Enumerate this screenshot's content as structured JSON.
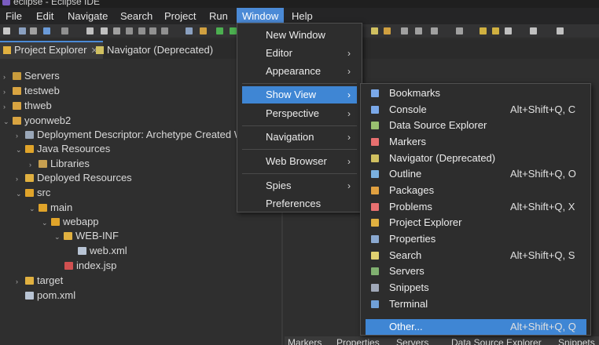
{
  "window": {
    "title": "eclipse - Eclipse IDE"
  },
  "menubar": [
    "File",
    "Edit",
    "Navigate",
    "Search",
    "Project",
    "Run",
    "Window",
    "Help"
  ],
  "tabs": {
    "project_explorer": "Project Explorer",
    "navigator": "Navigator (Deprecated)"
  },
  "tree": [
    {
      "label": "Servers",
      "icon_color": "#c89b3c"
    },
    {
      "label": "testweb",
      "icon_color": "#d9a441"
    },
    {
      "label": "thweb",
      "icon_color": "#d9a441"
    },
    {
      "label": "yoonweb2",
      "icon_color": "#d9a441"
    },
    {
      "label": "Deployment Descriptor: Archetype Created Web Application",
      "icon_color": "#9aa7b8"
    },
    {
      "label": "Java Resources",
      "icon_color": "#e0a42a"
    },
    {
      "label": "Libraries",
      "icon_color": "#c8a050"
    },
    {
      "label": "Deployed Resources",
      "icon_color": "#e0b040"
    },
    {
      "label": "src",
      "icon_color": "#e0a42a"
    },
    {
      "label": "main",
      "icon_color": "#e0a42a"
    },
    {
      "label": "webapp",
      "icon_color": "#e0a42a"
    },
    {
      "label": "WEB-INF",
      "icon_color": "#e0b040"
    },
    {
      "label": "web.xml",
      "icon_color": "#b8c4d4"
    },
    {
      "label": "index.jsp",
      "icon_color": "#d05050"
    },
    {
      "label": "target",
      "icon_color": "#e0b040"
    },
    {
      "label": "pom.xml",
      "icon_color": "#b8c4d4"
    }
  ],
  "window_menu": [
    {
      "label": "New Window",
      "arrow": ""
    },
    {
      "label": "Editor",
      "arrow": "›"
    },
    {
      "label": "Appearance",
      "arrow": "›"
    },
    {
      "label": "Show View",
      "arrow": "›"
    },
    {
      "label": "Perspective",
      "arrow": "›"
    },
    {
      "label": "Navigation",
      "arrow": "›"
    },
    {
      "label": "Web Browser",
      "arrow": "›"
    },
    {
      "label": "Spies",
      "arrow": "›"
    },
    {
      "label": "Preferences",
      "arrow": ""
    }
  ],
  "show_view_menu": [
    {
      "label": "Bookmarks",
      "shortcut": "",
      "icon_color": "#7aa8e8"
    },
    {
      "label": "Console",
      "shortcut": "Alt+Shift+Q, C",
      "icon_color": "#7aa8e8"
    },
    {
      "label": "Data Source Explorer",
      "shortcut": "",
      "icon_color": "#9ac070"
    },
    {
      "label": "Markers",
      "shortcut": "",
      "icon_color": "#e87070"
    },
    {
      "label": "Navigator (Deprecated)",
      "shortcut": "",
      "icon_color": "#d0c060"
    },
    {
      "label": "Outline",
      "shortcut": "Alt+Shift+Q, O",
      "icon_color": "#7ab0e0"
    },
    {
      "label": "Packages",
      "shortcut": "",
      "icon_color": "#e0a040"
    },
    {
      "label": "Problems",
      "shortcut": "Alt+Shift+Q, X",
      "icon_color": "#e87070"
    },
    {
      "label": "Project Explorer",
      "shortcut": "",
      "icon_color": "#e0b040"
    },
    {
      "label": "Properties",
      "shortcut": "",
      "icon_color": "#8aa8d0"
    },
    {
      "label": "Search",
      "shortcut": "Alt+Shift+Q, S",
      "icon_color": "#e0d070"
    },
    {
      "label": "Servers",
      "shortcut": "",
      "icon_color": "#80b070"
    },
    {
      "label": "Snippets",
      "shortcut": "",
      "icon_color": "#a0a8b8"
    },
    {
      "label": "Terminal",
      "shortcut": "",
      "icon_color": "#70a0d8"
    },
    {
      "label": "Other...",
      "shortcut": "Alt+Shift+Q, Q",
      "icon_color": ""
    }
  ],
  "bottom_tabs": [
    "Markers",
    "Properties",
    "Servers",
    "Data Source Explorer",
    "Snippets"
  ]
}
